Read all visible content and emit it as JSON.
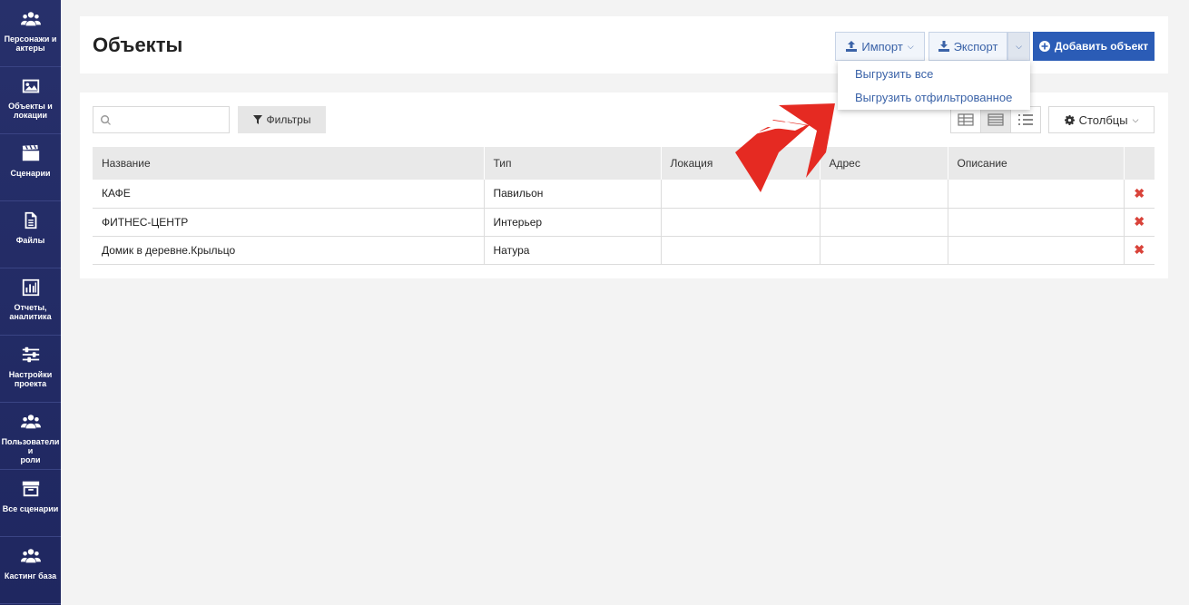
{
  "sidebar": {
    "items": [
      {
        "label": "Персонажи и\nактеры",
        "icon": "people-icon"
      },
      {
        "label": "Объекты и\nлокации",
        "icon": "image-icon"
      },
      {
        "label": "Сценарии",
        "icon": "clapperboard-icon"
      },
      {
        "label": "Файлы",
        "icon": "file-icon"
      },
      {
        "label": "Отчеты,\nаналитика",
        "icon": "bar-chart-icon"
      },
      {
        "label": "Настройки\nпроекта",
        "icon": "sliders-icon"
      },
      {
        "label": "Пользователи и\nроли",
        "icon": "people-icon"
      },
      {
        "label": "Все сценарии",
        "icon": "archive-icon"
      },
      {
        "label": "Кастинг база",
        "icon": "people-icon"
      }
    ]
  },
  "header": {
    "title": "Объекты",
    "import_label": "Импорт",
    "export_label": "Экспорт",
    "add_label": "Добавить объект"
  },
  "export_menu": {
    "items": [
      "Выгрузить все",
      "Выгрузить отфильтрованное"
    ]
  },
  "toolbar": {
    "search_placeholder": "",
    "filter_label": "Фильтры",
    "columns_label": "Столбцы"
  },
  "table": {
    "columns": [
      "Название",
      "Тип",
      "Локация",
      "Адрес",
      "Описание"
    ],
    "rows": [
      {
        "name": "КАФЕ",
        "type": "Павильон",
        "location": "",
        "address": "",
        "description": ""
      },
      {
        "name": "ФИТНЕС-ЦЕНТР",
        "type": "Интерьер",
        "location": "",
        "address": "",
        "description": ""
      },
      {
        "name": "Домик в деревне.Крыльцо",
        "type": "Натура",
        "location": "",
        "address": "",
        "description": ""
      }
    ],
    "delete_glyph": "✖"
  },
  "colors": {
    "sidebar_bg": "#27306b",
    "primary": "#2b5cb6",
    "link": "#3b63a8",
    "delete": "#d9433a",
    "annotation_arrow": "#e52a22"
  }
}
